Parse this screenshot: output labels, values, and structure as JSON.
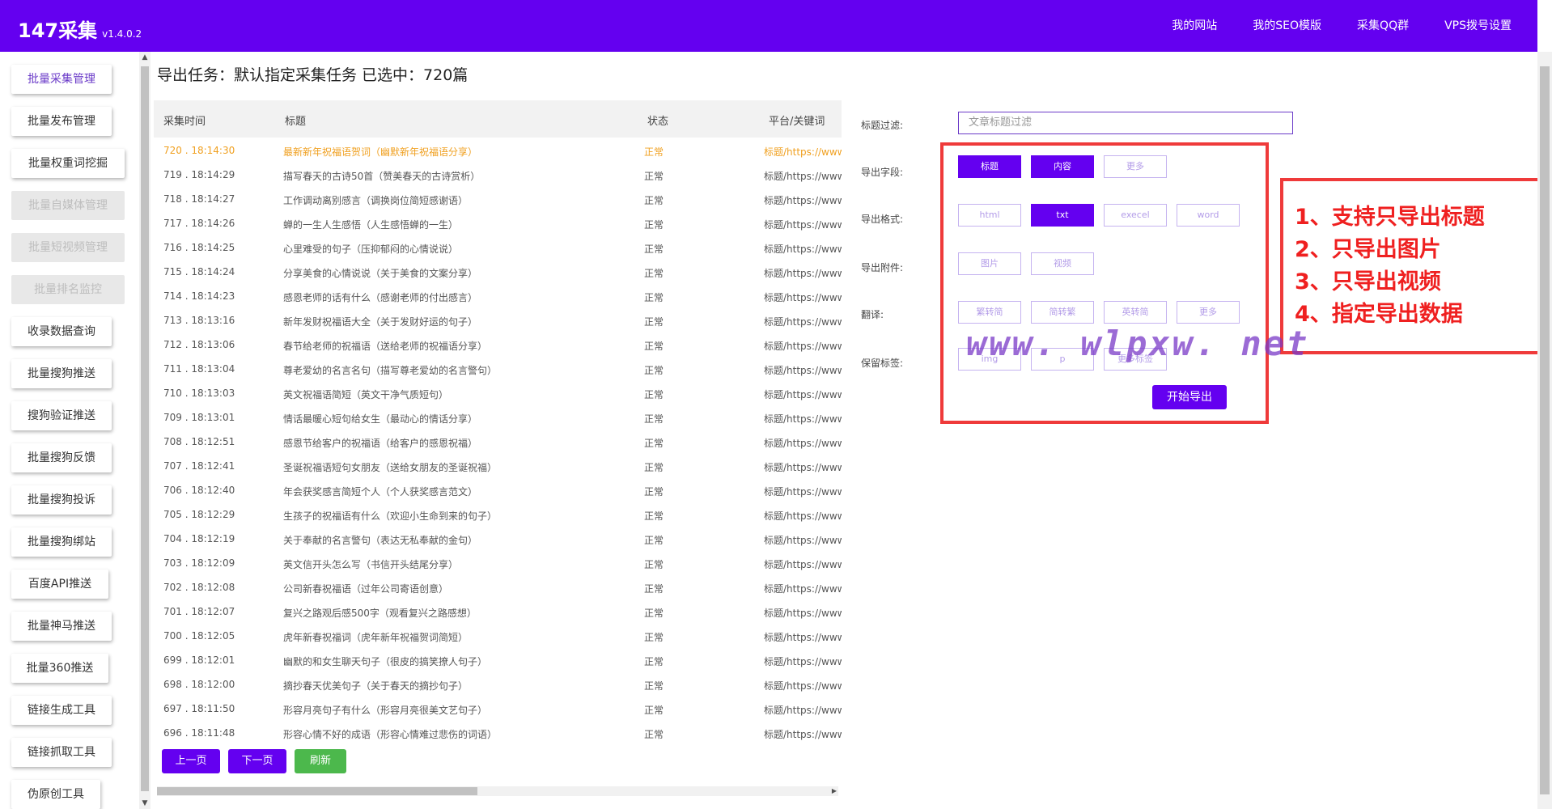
{
  "app": {
    "name": "147采集",
    "version": "v1.4.0.2"
  },
  "topnav": [
    "我的网站",
    "我的SEO模版",
    "采集QQ群",
    "VPS拨号设置"
  ],
  "sidebar": [
    {
      "label": "批量采集管理",
      "state": "active"
    },
    {
      "label": "批量发布管理",
      "state": "normal"
    },
    {
      "label": "批量权重词挖掘",
      "state": "normal"
    },
    {
      "label": "批量自媒体管理",
      "state": "disabled"
    },
    {
      "label": "批量短视频管理",
      "state": "disabled"
    },
    {
      "label": "批量排名监控",
      "state": "disabled"
    },
    {
      "label": "收录数据查询",
      "state": "normal"
    },
    {
      "label": "批量搜狗推送",
      "state": "normal"
    },
    {
      "label": "搜狗验证推送",
      "state": "normal"
    },
    {
      "label": "批量搜狗反馈",
      "state": "normal"
    },
    {
      "label": "批量搜狗投诉",
      "state": "normal"
    },
    {
      "label": "批量搜狗绑站",
      "state": "normal"
    },
    {
      "label": "百度API推送",
      "state": "normal"
    },
    {
      "label": "批量神马推送",
      "state": "normal"
    },
    {
      "label": "批量360推送",
      "state": "normal"
    },
    {
      "label": "链接生成工具",
      "state": "normal"
    },
    {
      "label": "链接抓取工具",
      "state": "normal"
    },
    {
      "label": "伪原创工具",
      "state": "normal"
    }
  ],
  "page_title": "导出任务：默认指定采集任务 已选中：720篇",
  "table": {
    "headers": [
      "采集时间",
      "标题",
      "状态",
      "平台/关键词"
    ],
    "rows": [
      {
        "time": "720 . 18:14:30",
        "title": "最新新年祝福语贺词（幽默新年祝福语分享）",
        "status": "正常",
        "platform": "标题/https://www.r",
        "highlight": true
      },
      {
        "time": "719 . 18:14:29",
        "title": "描写春天的古诗50首（赞美春天的古诗赏析）",
        "status": "正常",
        "platform": "标题/https://www.r"
      },
      {
        "time": "718 . 18:14:27",
        "title": "工作调动离别感言（调换岗位简短感谢语）",
        "status": "正常",
        "platform": "标题/https://www.r"
      },
      {
        "time": "717 . 18:14:26",
        "title": "蝉的一生人生感悟（人生感悟蝉的一生）",
        "status": "正常",
        "platform": "标题/https://www.r"
      },
      {
        "time": "716 . 18:14:25",
        "title": "心里难受的句子（压抑郁闷的心情说说）",
        "status": "正常",
        "platform": "标题/https://www.r"
      },
      {
        "time": "715 . 18:14:24",
        "title": "分享美食的心情说说（关于美食的文案分享）",
        "status": "正常",
        "platform": "标题/https://www.r"
      },
      {
        "time": "714 . 18:14:23",
        "title": "感恩老师的话有什么（感谢老师的付出感言）",
        "status": "正常",
        "platform": "标题/https://www.r"
      },
      {
        "time": "713 . 18:13:16",
        "title": "新年发财祝福语大全（关于发财好运的句子）",
        "status": "正常",
        "platform": "标题/https://www.r"
      },
      {
        "time": "712 . 18:13:06",
        "title": "春节给老师的祝福语（送给老师的祝福语分享）",
        "status": "正常",
        "platform": "标题/https://www.r"
      },
      {
        "time": "711 . 18:13:04",
        "title": "尊老爱幼的名言名句（描写尊老爱幼的名言警句）",
        "status": "正常",
        "platform": "标题/https://www.r"
      },
      {
        "time": "710 . 18:13:03",
        "title": "英文祝福语简短（英文干净气质短句）",
        "status": "正常",
        "platform": "标题/https://www.r"
      },
      {
        "time": "709 . 18:13:01",
        "title": "情话最暖心短句给女生（最动心的情话分享）",
        "status": "正常",
        "platform": "标题/https://www.r"
      },
      {
        "time": "708 . 18:12:51",
        "title": "感恩节给客户的祝福语（给客户的感恩祝福）",
        "status": "正常",
        "platform": "标题/https://www.r"
      },
      {
        "time": "707 . 18:12:41",
        "title": "圣诞祝福语短句女朋友（送给女朋友的圣诞祝福）",
        "status": "正常",
        "platform": "标题/https://www.r"
      },
      {
        "time": "706 . 18:12:40",
        "title": "年会获奖感言简短个人（个人获奖感言范文）",
        "status": "正常",
        "platform": "标题/https://www.r"
      },
      {
        "time": "705 . 18:12:29",
        "title": "生孩子的祝福语有什么（欢迎小生命到来的句子）",
        "status": "正常",
        "platform": "标题/https://www.r"
      },
      {
        "time": "704 . 18:12:19",
        "title": "关于奉献的名言警句（表达无私奉献的金句）",
        "status": "正常",
        "platform": "标题/https://www.r"
      },
      {
        "time": "703 . 18:12:09",
        "title": "英文信开头怎么写（书信开头结尾分享）",
        "status": "正常",
        "platform": "标题/https://www.r"
      },
      {
        "time": "702 . 18:12:08",
        "title": "公司新春祝福语（过年公司寄语创意）",
        "status": "正常",
        "platform": "标题/https://www.r"
      },
      {
        "time": "701 . 18:12:07",
        "title": "复兴之路观后感500字（观看复兴之路感想）",
        "status": "正常",
        "platform": "标题/https://www.r"
      },
      {
        "time": "700 . 18:12:05",
        "title": "虎年新春祝福词（虎年新年祝福贺词简短）",
        "status": "正常",
        "platform": "标题/https://www.r"
      },
      {
        "time": "699 . 18:12:01",
        "title": "幽默的和女生聊天句子（很皮的搞笑撩人句子）",
        "status": "正常",
        "platform": "标题/https://www.r"
      },
      {
        "time": "698 . 18:12:00",
        "title": "摘抄春天优美句子（关于春天的摘抄句子）",
        "status": "正常",
        "platform": "标题/https://www.r"
      },
      {
        "time": "697 . 18:11:50",
        "title": "形容月亮句子有什么（形容月亮很美文艺句子）",
        "status": "正常",
        "platform": "标题/https://www.r"
      },
      {
        "time": "696 . 18:11:48",
        "title": "形容心情不好的成语（形容心情难过悲伤的词语）",
        "status": "正常",
        "platform": "标题/https://www.r"
      }
    ]
  },
  "pager": {
    "prev": "上一页",
    "next": "下一页",
    "refresh": "刷新"
  },
  "export": {
    "filter_label": "标题过滤:",
    "filter_placeholder": "文章标题过滤",
    "fields_label": "导出字段:",
    "fields": [
      {
        "label": "标题",
        "on": true
      },
      {
        "label": "内容",
        "on": true
      },
      {
        "label": "更多",
        "on": false
      }
    ],
    "format_label": "导出格式:",
    "formats": [
      {
        "label": "html",
        "on": false
      },
      {
        "label": "txt",
        "on": true
      },
      {
        "label": "execel",
        "on": false
      },
      {
        "label": "word",
        "on": false
      }
    ],
    "attach_label": "导出附件:",
    "attachments": [
      {
        "label": "图片",
        "on": false
      },
      {
        "label": "视频",
        "on": false
      }
    ],
    "translate_label": "翻译:",
    "translations": [
      {
        "label": "繁转简",
        "on": false
      },
      {
        "label": "简转繁",
        "on": false
      },
      {
        "label": "英转简",
        "on": false
      },
      {
        "label": "更多",
        "on": false
      }
    ],
    "keep_label": "保留标签:",
    "keep_tags": [
      {
        "label": "img",
        "on": false
      },
      {
        "label": "p",
        "on": false
      },
      {
        "label": "更多标签",
        "on": false
      }
    ],
    "start_button": "开始导出"
  },
  "annotation": {
    "lines": [
      "1、支持只导出标题",
      "2、只导出图片",
      "3、只导出视频",
      "4、指定导出数据"
    ],
    "watermark": "www. wlpxw. net",
    "color": "#ef3a3a"
  },
  "colors": {
    "brand": "#6400f0",
    "highlight": "#f0a020",
    "refresh": "#4cb84c"
  }
}
